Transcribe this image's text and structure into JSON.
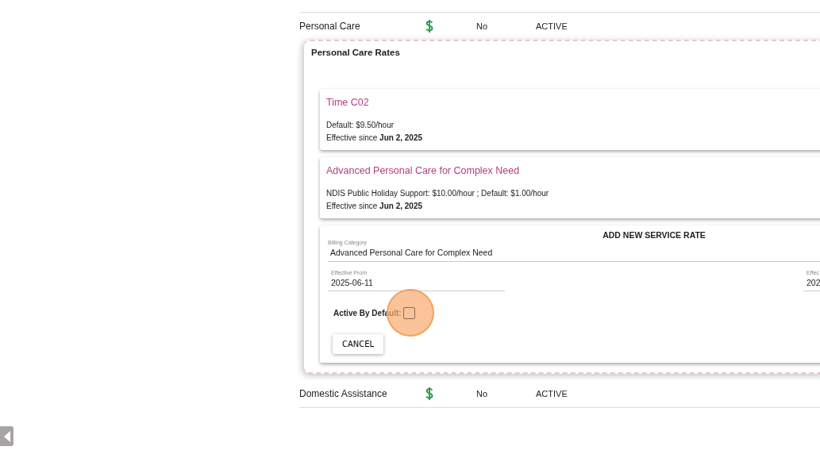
{
  "services": [
    {
      "name": "Personal Care",
      "billable": true,
      "flag": "No",
      "status": "ACTIVE",
      "expanded": true
    },
    {
      "name": "Domestic Assistance",
      "billable": true,
      "flag": "No",
      "status": "ACTIVE",
      "expanded": false
    }
  ],
  "rates_panel": {
    "title": "Personal Care Rates",
    "rates": [
      {
        "name": "Time C02",
        "pricing": "Default: $9.50/hour",
        "effective": "Effective since **Jun 2, 2025**"
      },
      {
        "name": "Advanced Personal Care for Complex Need",
        "pricing": "NDIS Public Holiday Support: $10.00/hour ; Default: $1.00/hour",
        "effective": "Effective since **Jun 2, 2025**"
      }
    ],
    "new_rate_form": {
      "title": "ADD NEW SERVICE RATE",
      "billing_category": {
        "label": "Billing Category",
        "value": "Advanced Personal Care for Complex Need"
      },
      "date_fields": [
        {
          "label": "Effective From",
          "value": "2025-06-11"
        },
        {
          "label": "Effec",
          "value": "202"
        }
      ],
      "active_by_default": {
        "label": "Active By Default:",
        "checked": false
      },
      "cancel_button": "CANCEL"
    }
  }
}
